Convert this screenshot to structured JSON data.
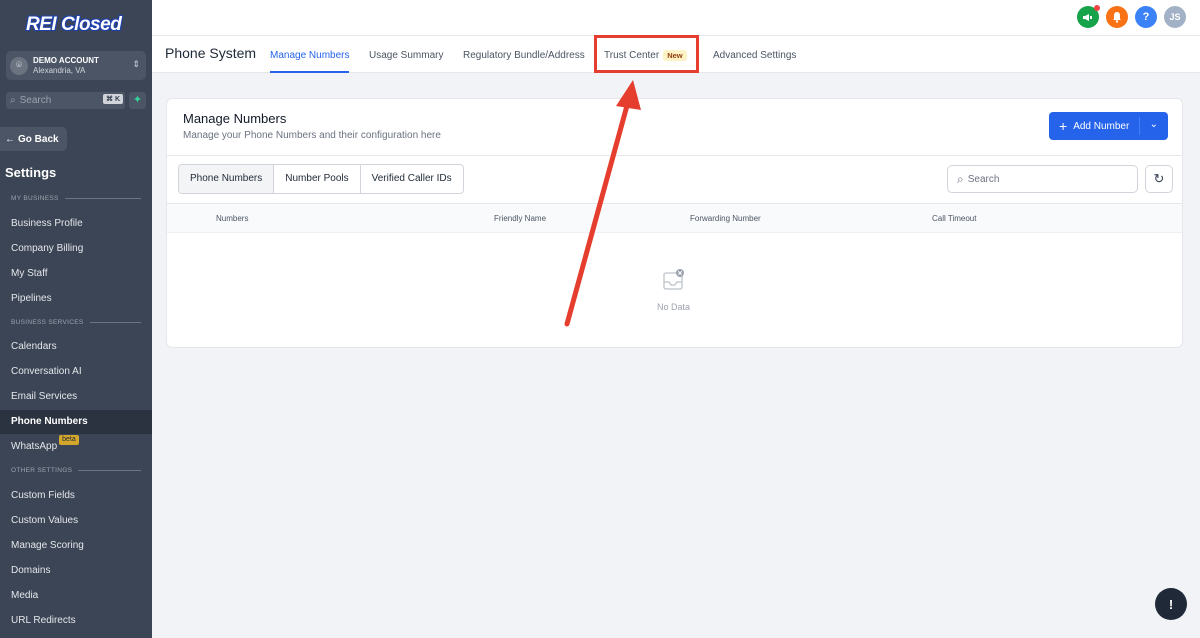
{
  "sidebar": {
    "logo": "REI Closed",
    "account": {
      "name": "DEMO ACCOUNT",
      "location": "Alexandria, VA"
    },
    "search": {
      "placeholder": "Search",
      "shortcut": "⌘ K"
    },
    "go_back": "Go Back",
    "settings_title": "Settings",
    "sections": {
      "my_business": "MY BUSINESS",
      "business_services": "BUSINESS SERVICES",
      "other_settings": "OTHER SETTINGS"
    },
    "items": [
      {
        "label": "Business Profile"
      },
      {
        "label": "Company Billing"
      },
      {
        "label": "My Staff"
      },
      {
        "label": "Pipelines"
      },
      {
        "label": "Calendars"
      },
      {
        "label": "Conversation AI"
      },
      {
        "label": "Email Services"
      },
      {
        "label": "Phone Numbers",
        "active": true
      },
      {
        "label": "WhatsApp",
        "badge": "beta"
      },
      {
        "label": "Custom Fields"
      },
      {
        "label": "Custom Values"
      },
      {
        "label": "Manage Scoring"
      },
      {
        "label": "Domains"
      },
      {
        "label": "Media"
      },
      {
        "label": "URL Redirects"
      }
    ]
  },
  "topbar": {
    "icons": [
      "megaphone-icon",
      "bell-icon",
      "help-icon"
    ],
    "help_glyph": "?",
    "avatar_initials": "JS"
  },
  "subnav": {
    "title": "Phone System",
    "tabs": [
      {
        "label": "Manage Numbers",
        "active": true
      },
      {
        "label": "Usage Summary"
      },
      {
        "label": "Regulatory Bundle/Address"
      },
      {
        "label": "Trust Center",
        "badge": "New"
      },
      {
        "label": "Advanced Settings"
      }
    ]
  },
  "card": {
    "title": "Manage Numbers",
    "subtitle": "Manage your Phone Numbers and their configuration here",
    "add_button": "Add Number",
    "segments": [
      "Phone Numbers",
      "Number Pools",
      "Verified Caller IDs"
    ],
    "search_placeholder": "Search",
    "columns": [
      "Numbers",
      "Friendly Name",
      "Forwarding Number",
      "Call Timeout"
    ],
    "empty_text": "No Data"
  },
  "colors": {
    "sidebar_bg": "#3b4555",
    "accent": "#2563eb",
    "annotation": "#e53e2e"
  }
}
